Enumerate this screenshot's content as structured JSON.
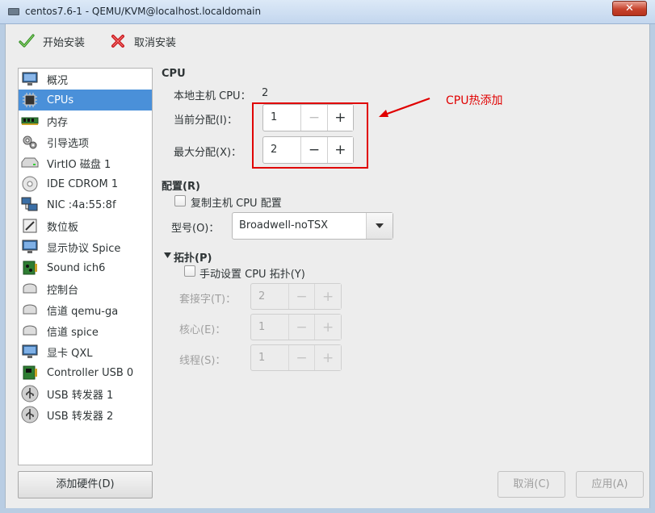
{
  "window": {
    "title": "centos7.6-1 - QEMU/KVM@localhost.localdomain",
    "close_glyph": "✕"
  },
  "toolbar": {
    "begin_install": "开始安装",
    "cancel_install": "取消安装"
  },
  "hardware_list": [
    {
      "label": "概况",
      "icon": "overview-icon",
      "selected": false
    },
    {
      "label": "CPUs",
      "icon": "cpu-icon",
      "selected": true
    },
    {
      "label": "内存",
      "icon": "memory-icon",
      "selected": false
    },
    {
      "label": "引导选项",
      "icon": "boot-options-icon",
      "selected": false
    },
    {
      "label": "VirtIO 磁盘 1",
      "icon": "disk-icon",
      "selected": false
    },
    {
      "label": "IDE CDROM 1",
      "icon": "cdrom-icon",
      "selected": false
    },
    {
      "label": "NIC :4a:55:8f",
      "icon": "nic-icon",
      "selected": false
    },
    {
      "label": "数位板",
      "icon": "tablet-icon",
      "selected": false
    },
    {
      "label": "显示协议 Spice",
      "icon": "display-icon",
      "selected": false
    },
    {
      "label": "Sound ich6",
      "icon": "sound-icon",
      "selected": false
    },
    {
      "label": "控制台",
      "icon": "console-icon",
      "selected": false
    },
    {
      "label": "信道 qemu-ga",
      "icon": "channel-icon",
      "selected": false
    },
    {
      "label": "信道 spice",
      "icon": "channel-icon",
      "selected": false
    },
    {
      "label": "显卡 QXL",
      "icon": "video-icon",
      "selected": false
    },
    {
      "label": "Controller USB 0",
      "icon": "controller-icon",
      "selected": false
    },
    {
      "label": "USB 转发器 1",
      "icon": "usb-icon",
      "selected": false
    },
    {
      "label": "USB 转发器 2",
      "icon": "usb-icon",
      "selected": false
    }
  ],
  "add_hardware": "添加硬件(D)",
  "cpu": {
    "heading": "CPU",
    "host_cpu_label": "本地主机 CPU：",
    "host_cpu_value": "2",
    "current_label": "当前分配(I)：",
    "current_value": "1",
    "max_label": "最大分配(X)：",
    "max_value": "2"
  },
  "config": {
    "heading": "配置(R)",
    "copy_host_label": "复制主机 CPU 配置",
    "copy_host_checked": false,
    "model_label": "型号(O)：",
    "model_value": "Broadwell-noTSX"
  },
  "topology": {
    "heading": "拓扑(P)",
    "manual_label": "手动设置 CPU 拓扑(Y)",
    "manual_checked": false,
    "sockets_label": "套接字(T)：",
    "sockets_value": "2",
    "cores_label": "核心(E)：",
    "cores_value": "1",
    "threads_label": "线程(S)：",
    "threads_value": "1"
  },
  "spin_glyphs": {
    "minus": "−",
    "plus": "+"
  },
  "annotation": {
    "text": "CPU热添加",
    "color": "#e00000"
  },
  "buttons": {
    "cancel": "取消(C)",
    "apply": "应用(A)"
  },
  "colors": {
    "selection": "#4a90d9",
    "annotation": "#e00000"
  }
}
